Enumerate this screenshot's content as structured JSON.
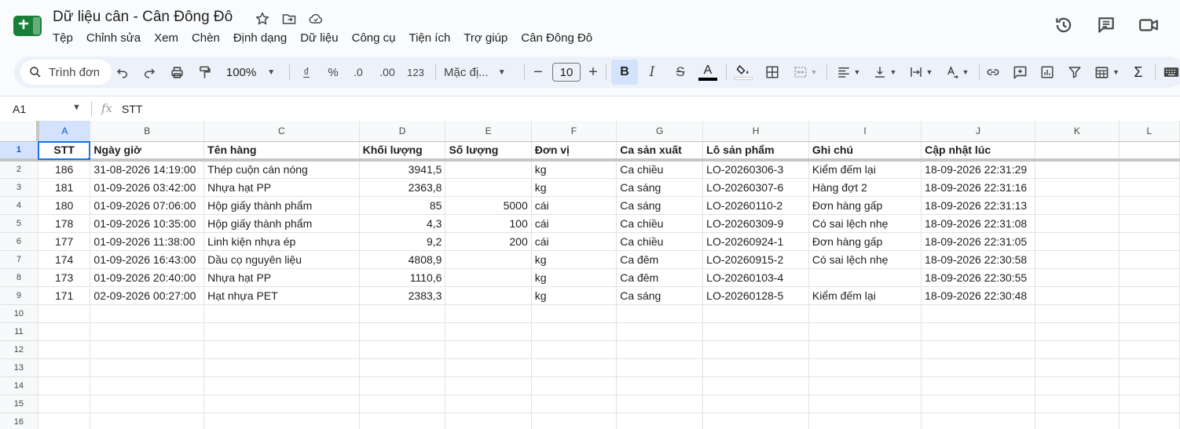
{
  "app": {
    "doc_title": "Dữ liệu cân - Cân Đông Đô",
    "menu": [
      "Tệp",
      "Chỉnh sửa",
      "Xem",
      "Chèn",
      "Định dạng",
      "Dữ liệu",
      "Công cụ",
      "Tiện ích",
      "Trợ giúp",
      "Cân Đông Đô"
    ],
    "accent": "#1a73e8",
    "logo_color": "#188038"
  },
  "toolbar": {
    "search_placeholder": "Trình đơn",
    "zoom": "100%",
    "currency": "₫",
    "percent": "%",
    "dec_decrease": ".0",
    "dec_increase": ".00",
    "number_format": "123",
    "font": "Mặc đị...",
    "font_size": "10",
    "bold": "B",
    "italic": "I",
    "strike": "S",
    "text_color": "A"
  },
  "formula_bar": {
    "cell_ref": "A1",
    "fx": "fx",
    "value": "STT"
  },
  "sheet": {
    "columns": [
      "A",
      "B",
      "C",
      "D",
      "E",
      "F",
      "G",
      "H",
      "I",
      "J",
      "K",
      "L"
    ],
    "header": [
      "STT",
      "Ngày giờ",
      "Tên hàng",
      "Khối lượng",
      "Số lượng",
      "Đơn vị",
      "Ca sản xuất",
      "Lô sản phẩm",
      "Ghi chú",
      "Cập nhật lúc",
      "",
      ""
    ],
    "rows": [
      [
        "186",
        "31-08-2026 14:19:00",
        "Thép cuộn cán nóng",
        "3941,5",
        "",
        "kg",
        "Ca chiều",
        "LO-20260306-3",
        "Kiểm đếm lại",
        "18-09-2026 22:31:29",
        "",
        ""
      ],
      [
        "181",
        "01-09-2026 03:42:00",
        "Nhựa hạt PP",
        "2363,8",
        "",
        "kg",
        "Ca sáng",
        "LO-20260307-6",
        "Hàng đợt 2",
        "18-09-2026 22:31:16",
        "",
        ""
      ],
      [
        "180",
        "01-09-2026 07:06:00",
        "Hộp giấy thành phẩm",
        "85",
        "5000",
        "cái",
        "Ca sáng",
        "LO-20260110-2",
        "Đơn hàng gấp",
        "18-09-2026 22:31:13",
        "",
        ""
      ],
      [
        "178",
        "01-09-2026 10:35:00",
        "Hộp giấy thành phẩm",
        "4,3",
        "100",
        "cái",
        "Ca chiều",
        "LO-20260309-9",
        "Có sai lệch nhẹ",
        "18-09-2026 22:31:08",
        "",
        ""
      ],
      [
        "177",
        "01-09-2026 11:38:00",
        "Linh kiện nhựa ép",
        "9,2",
        "200",
        "cái",
        "Ca chiều",
        "LO-20260924-1",
        "Đơn hàng gấp",
        "18-09-2026 22:31:05",
        "",
        ""
      ],
      [
        "174",
        "01-09-2026 16:43:00",
        "Dầu cọ nguyên liệu",
        "4808,9",
        "",
        "kg",
        "Ca đêm",
        "LO-20260915-2",
        "Có sai lệch nhẹ",
        "18-09-2026 22:30:58",
        "",
        ""
      ],
      [
        "173",
        "01-09-2026 20:40:00",
        "Nhựa hạt PP",
        "1110,6",
        "",
        "kg",
        "Ca đêm",
        "LO-20260103-4",
        "",
        "18-09-2026 22:30:55",
        "",
        ""
      ],
      [
        "171",
        "02-09-2026 00:27:00",
        "Hạt nhựa PET",
        "2383,3",
        "",
        "kg",
        "Ca sáng",
        "LO-20260128-5",
        "Kiểm đếm lại",
        "18-09-2026 22:30:48",
        "",
        ""
      ]
    ],
    "row_numbers": [
      "1",
      "2",
      "3",
      "4",
      "5",
      "6",
      "7",
      "8",
      "9",
      "10",
      "11",
      "12",
      "13",
      "14",
      "15",
      "16"
    ]
  }
}
